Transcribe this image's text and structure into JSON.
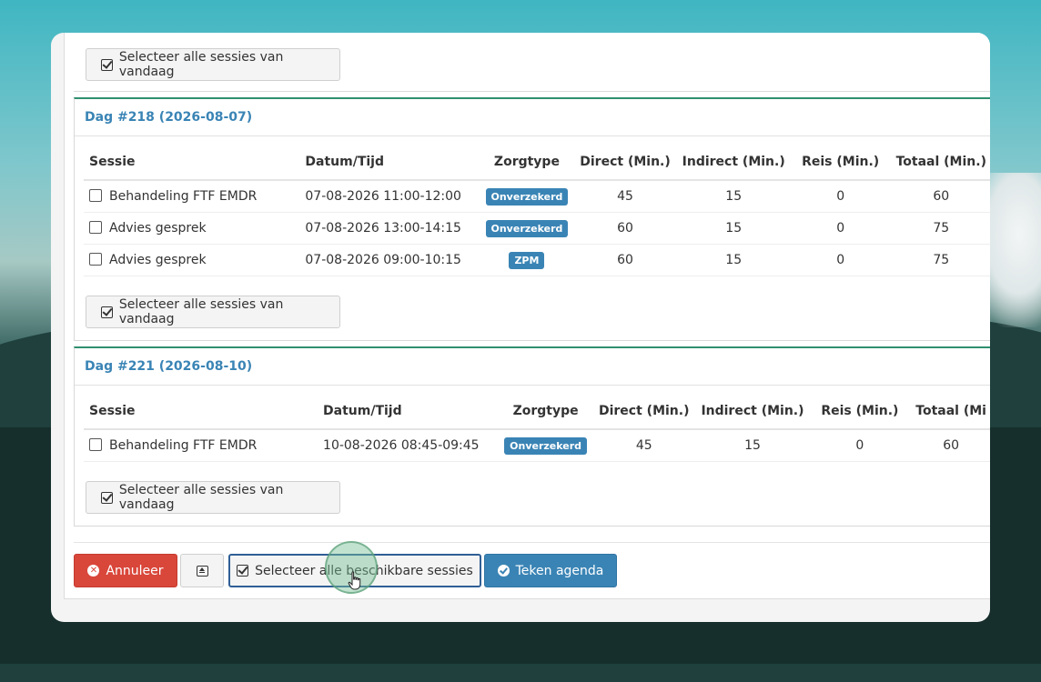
{
  "select_today_label": "Selecteer alle sessies van vandaag",
  "columns": [
    "Sessie",
    "Datum/Tijd",
    "Zorgtype",
    "Direct (Min.)",
    "Indirect (Min.)",
    "Reis (Min.)",
    "Totaal (Min.)"
  ],
  "columns_cut": [
    "Sessie",
    "Datum/Tijd",
    "Zorgtype",
    "Direct (Min.)",
    "Indirect (Min.)",
    "Reis (Min.)",
    "Totaal (Mi"
  ],
  "days": [
    {
      "title": "Dag #218 (2026-08-07)",
      "rows": [
        {
          "session": "Behandeling FTF EMDR",
          "datetime": "07-08-2026 11:00-12:00",
          "type": "Onverzekerd",
          "direct": "45",
          "indirect": "15",
          "travel": "0",
          "total": "60"
        },
        {
          "session": "Advies gesprek",
          "datetime": "07-08-2026 13:00-14:15",
          "type": "Onverzekerd",
          "direct": "60",
          "indirect": "15",
          "travel": "0",
          "total": "75"
        },
        {
          "session": "Advies gesprek",
          "datetime": "07-08-2026 09:00-10:15",
          "type": "ZPM",
          "direct": "60",
          "indirect": "15",
          "travel": "0",
          "total": "75"
        }
      ]
    },
    {
      "title": "Dag #221 (2026-08-10)",
      "rows": [
        {
          "session": "Behandeling FTF EMDR",
          "datetime": "10-08-2026 08:45-09:45",
          "type": "Onverzekerd",
          "direct": "45",
          "indirect": "15",
          "travel": "0",
          "total": "60"
        }
      ]
    }
  ],
  "footer": {
    "cancel": "Annuleer",
    "select_all": "Selecteer alle beschikbare sessies",
    "sign": "Teken agenda"
  },
  "colors": {
    "accent": "#3a84b5",
    "danger": "#d9463a",
    "panel_border": "#2f8f6f"
  }
}
